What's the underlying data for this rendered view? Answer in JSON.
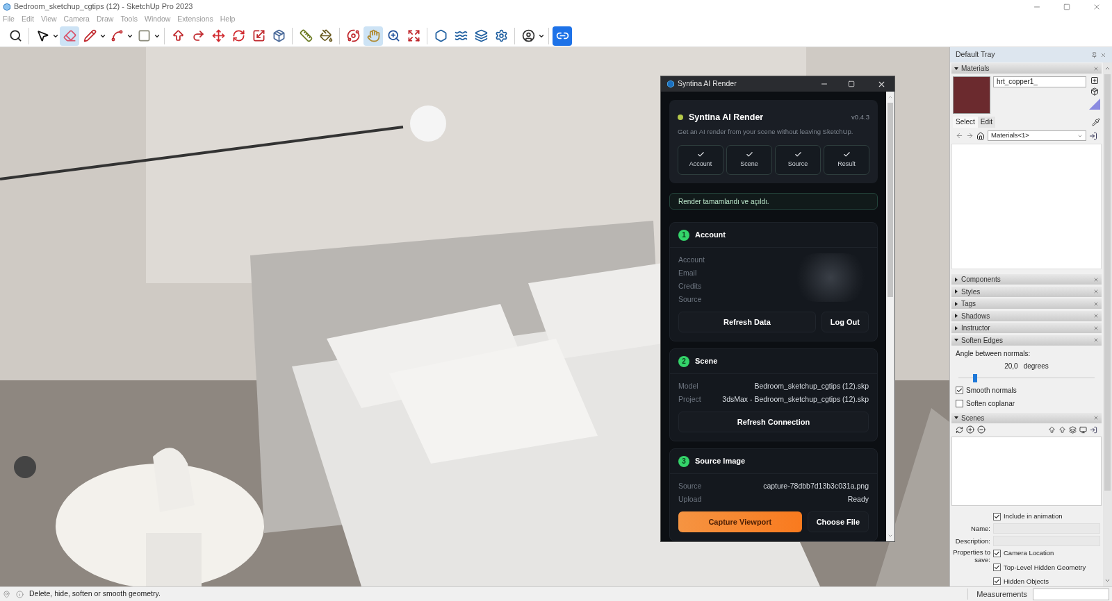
{
  "window": {
    "title": "Bedroom_sketchup_cgtips (12) - SketchUp Pro 2023"
  },
  "menu": [
    "File",
    "Edit",
    "View",
    "Camera",
    "Draw",
    "Tools",
    "Window",
    "Extensions",
    "Help"
  ],
  "toolbar": [
    {
      "kind": "zoom",
      "selected": false,
      "dropdown": false
    },
    {
      "kind": "separator"
    },
    {
      "kind": "select",
      "selected": false,
      "dropdown": true
    },
    {
      "kind": "eraser",
      "selected": true,
      "dropdown": false
    },
    {
      "kind": "pencil",
      "selected": false,
      "dropdown": true
    },
    {
      "kind": "arc",
      "selected": false,
      "dropdown": true
    },
    {
      "kind": "rect",
      "selected": false,
      "dropdown": true
    },
    {
      "kind": "separator"
    },
    {
      "kind": "pushpull",
      "selected": false,
      "dropdown": false
    },
    {
      "kind": "followme",
      "selected": false,
      "dropdown": false
    },
    {
      "kind": "move",
      "selected": false,
      "dropdown": false
    },
    {
      "kind": "rotate",
      "selected": false,
      "dropdown": false
    },
    {
      "kind": "scale",
      "selected": false,
      "dropdown": false
    },
    {
      "kind": "offset",
      "selected": false,
      "dropdown": false
    },
    {
      "kind": "separator"
    },
    {
      "kind": "tape",
      "selected": false,
      "dropdown": false
    },
    {
      "kind": "paint",
      "selected": false,
      "dropdown": false
    },
    {
      "kind": "separator"
    },
    {
      "kind": "orbit",
      "selected": false,
      "dropdown": false
    },
    {
      "kind": "pan",
      "selected": true,
      "dropdown": false
    },
    {
      "kind": "zoomin",
      "selected": false,
      "dropdown": false
    },
    {
      "kind": "extents",
      "selected": false,
      "dropdown": false
    },
    {
      "kind": "separator"
    },
    {
      "kind": "hexagon",
      "selected": false,
      "dropdown": false
    },
    {
      "kind": "waves",
      "selected": false,
      "dropdown": false
    },
    {
      "kind": "layers",
      "selected": false,
      "dropdown": false
    },
    {
      "kind": "settings",
      "selected": false,
      "dropdown": false
    },
    {
      "kind": "separator"
    },
    {
      "kind": "user",
      "selected": false,
      "dropdown": true
    },
    {
      "kind": "separator"
    },
    {
      "kind": "plugin",
      "dropdown": false
    }
  ],
  "dialog": {
    "title": "Syntina AI Render",
    "header": {
      "title": "Syntina AI Render",
      "version": "v0.4.3",
      "subtitle": "Get an AI render from your scene without leaving SketchUp."
    },
    "steps": [
      {
        "label": "Account",
        "checked": true
      },
      {
        "label": "Scene",
        "checked": true
      },
      {
        "label": "Source",
        "checked": true
      },
      {
        "label": "Result",
        "checked": true
      }
    ],
    "notice": "Render tamamlandı ve açıldı.",
    "sections": [
      {
        "number": "1",
        "title": "Account",
        "blurred": true,
        "rows": [
          {
            "label": "Account"
          },
          {
            "label": "Email"
          },
          {
            "label": "Credits"
          },
          {
            "label": "Source"
          }
        ],
        "buttons": [
          {
            "label": "Refresh Data",
            "kind": "secondary"
          },
          {
            "label": "Log Out",
            "kind": "secondary"
          }
        ]
      },
      {
        "number": "2",
        "title": "Scene",
        "blurred": false,
        "rows": [
          {
            "label": "Model",
            "value": "Bedroom_sketchup_cgtips (12).skp"
          },
          {
            "label": "Project",
            "value": "3dsMax - Bedroom_sketchup_cgtips (12).skp"
          }
        ],
        "buttons": [
          {
            "label": "Refresh Connection",
            "kind": "secondary"
          }
        ]
      },
      {
        "number": "3",
        "title": "Source Image",
        "blurred": false,
        "rows": [
          {
            "label": "Source",
            "value": "capture-78dbb7d13b3c031a.png"
          },
          {
            "label": "Upload",
            "value": "Ready"
          }
        ],
        "buttons": [
          {
            "label": "Capture Viewport",
            "kind": "primary"
          },
          {
            "label": "Choose File",
            "kind": "secondary"
          }
        ]
      }
    ]
  },
  "tray": {
    "title": "Default Tray",
    "materials": {
      "title": "Materials",
      "expanded": true,
      "name": "hrt_copper1_",
      "tabs": [
        {
          "label": "Select",
          "selected": true
        },
        {
          "label": "Edit",
          "selected": false
        }
      ],
      "library": "Materials<1>"
    },
    "collapsed_panels": [
      {
        "title": "Components",
        "expanded": false
      },
      {
        "title": "Styles",
        "expanded": false
      },
      {
        "title": "Tags",
        "expanded": false
      },
      {
        "title": "Shadows",
        "expanded": false
      },
      {
        "title": "Instructor",
        "expanded": false
      }
    ],
    "soften_edges": {
      "title": "Soften Edges",
      "expanded": true,
      "angle_label": "Angle between normals:",
      "angle_value": "20,0",
      "angle_unit": "degrees",
      "level": 0.12,
      "options": [
        {
          "label": "Smooth normals",
          "checked": true
        },
        {
          "label": "Soften coplanar",
          "checked": false
        }
      ]
    },
    "scenes": {
      "title": "Scenes",
      "expanded": true,
      "include": {
        "label": "Include in animation",
        "checked": true
      },
      "name_label": "Name:",
      "description_label": "Description:",
      "properties_label": "Properties to save:",
      "properties": [
        {
          "label": "Camera Location",
          "checked": true
        },
        {
          "label": "Top-Level Hidden Geometry",
          "checked": true
        },
        {
          "label": "Hidden Objects",
          "checked": true
        }
      ]
    }
  },
  "status_bar": {
    "message": "Delete, hide, soften or smooth geometry.",
    "measurements_label": "Measurements"
  }
}
